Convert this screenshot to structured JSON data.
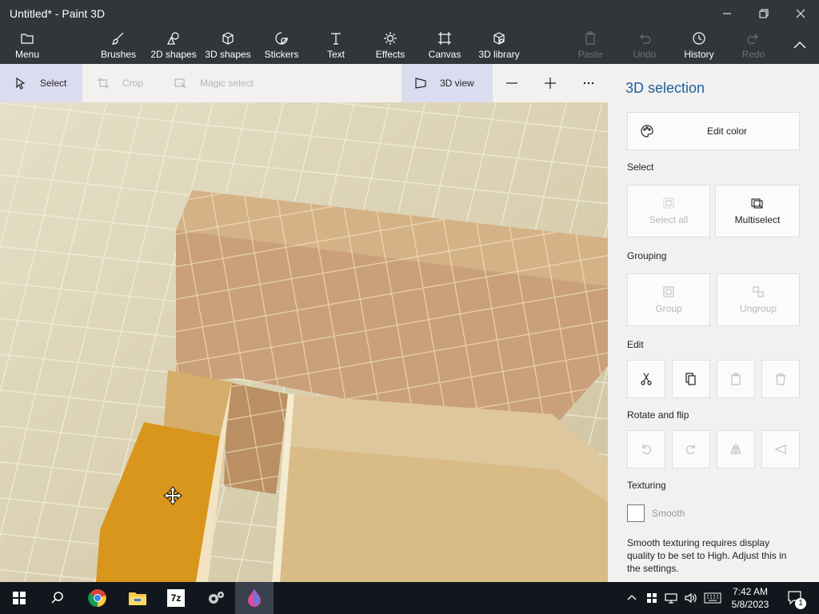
{
  "window": {
    "title": "Untitled* - Paint 3D"
  },
  "ribbon": {
    "menu": "Menu",
    "tools": [
      {
        "label": "Brushes",
        "icon": "brush-icon"
      },
      {
        "label": "2D shapes",
        "icon": "2d-shapes-icon"
      },
      {
        "label": "3D shapes",
        "icon": "3d-shapes-icon"
      },
      {
        "label": "Stickers",
        "icon": "stickers-icon"
      },
      {
        "label": "Text",
        "icon": "text-icon"
      },
      {
        "label": "Effects",
        "icon": "effects-icon"
      },
      {
        "label": "Canvas",
        "icon": "canvas-icon"
      },
      {
        "label": "3D library",
        "icon": "3d-library-icon"
      }
    ],
    "paste": "Paste",
    "undo": "Undo",
    "history": "History",
    "redo": "Redo"
  },
  "toolbar": {
    "select": "Select",
    "crop": "Crop",
    "magic_select": "Magic select",
    "view_3d": "3D view"
  },
  "panel": {
    "title": "3D selection",
    "edit_color": "Edit color",
    "select_heading": "Select",
    "select_all": "Select all",
    "multiselect": "Multiselect",
    "grouping_heading": "Grouping",
    "group": "Group",
    "ungroup": "Ungroup",
    "edit_heading": "Edit",
    "rotate_heading": "Rotate and flip",
    "texturing_heading": "Texturing",
    "smooth": "Smooth",
    "smooth_note": "Smooth texturing requires display quality to be set to High. Adjust this in the settings.",
    "smooth_checked": false
  },
  "taskbar": {
    "time": "7:42 AM",
    "date": "5/8/2023",
    "notification_count": "1",
    "zip_label": "7z"
  },
  "colors": {
    "accent": "#1f5f9e",
    "chrome": "#333639",
    "panel": "#f2f1f0",
    "taskbar": "#12171e"
  }
}
